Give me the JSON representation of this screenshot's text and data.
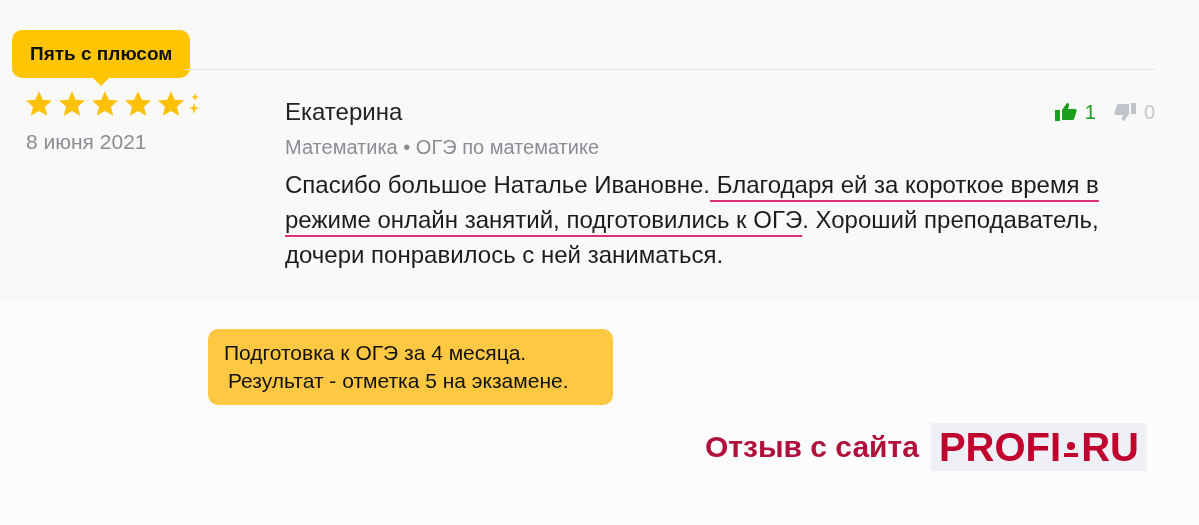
{
  "review": {
    "badge": "Пять с плюсом",
    "stars": 5,
    "date": "8 июня 2021",
    "author": "Екатерина",
    "subject": "Математика • ОГЭ по математике",
    "likes": {
      "count": "1",
      "active": true
    },
    "dislikes": {
      "count": "0",
      "active": false
    },
    "text_before": "Спасибо большое Наталье Ивановне.",
    "text_underlined": " Благодаря ей за короткое время в режиме онлайн занятий, подготовились к ОГЭ",
    "text_after": ". Хороший преподаватель, дочери понравилось с ней заниматься."
  },
  "note": {
    "lines": [
      "Подготовка к ОГЭ за 4 месяца.",
      "Результат - отметка 5 на экзамене."
    ]
  },
  "source": {
    "label": "Отзыв с сайта",
    "logo_left": "PROFI",
    "logo_right": "RU"
  }
}
